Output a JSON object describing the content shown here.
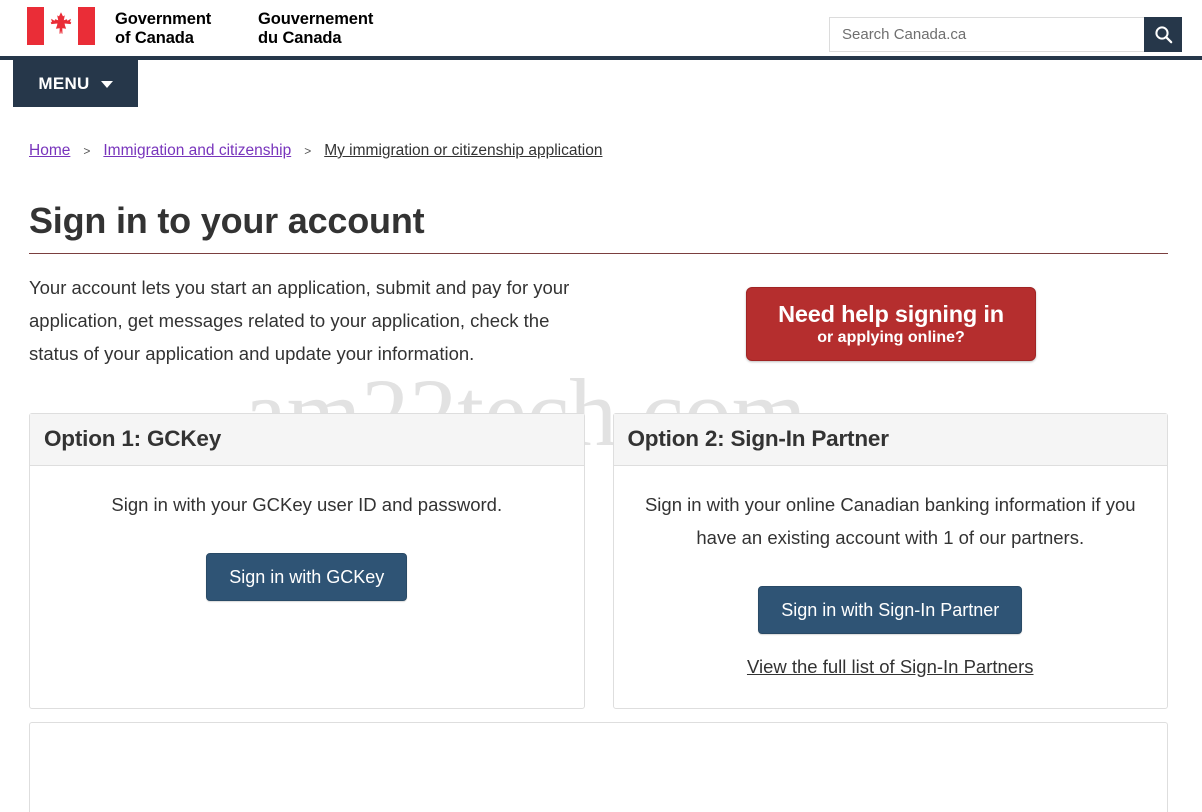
{
  "header": {
    "logo_alt": "Government of Canada / Gouvernement du Canada",
    "wordmark": {
      "en_line1": "Government",
      "en_line2": "of Canada",
      "fr_line1": "Gouvernement",
      "fr_line2": "du Canada"
    },
    "search": {
      "placeholder": "Search Canada.ca",
      "value": "",
      "button_icon": "search-icon"
    },
    "menu": {
      "label": "MENU",
      "caret_icon": "chevron-down-icon"
    }
  },
  "breadcrumb": {
    "separator": ">",
    "items": [
      {
        "label": "Home",
        "state": "visited"
      },
      {
        "label": "Immigration and citizenship",
        "state": "visited"
      },
      {
        "label": "My immigration or citizenship application",
        "state": "current"
      }
    ]
  },
  "main": {
    "title": "Sign in to your account",
    "intro": "Your account lets you start an application, submit and pay for your application, get messages related to your application, check the status of your application and update your information.",
    "help_button": {
      "line1": "Need help signing in",
      "line2": "or applying online?"
    },
    "options": [
      {
        "heading": "Option 1: GCKey",
        "description": "Sign in with your GCKey user ID and password.",
        "button_label": "Sign in with GCKey",
        "link_label": ""
      },
      {
        "heading": "Option 2: Sign-In Partner",
        "description": "Sign in with your online Canadian banking information if you have an existing account with 1 of our partners.",
        "button_label": "Sign in with Sign-In Partner",
        "link_label": "View the full list of Sign-In Partners"
      }
    ]
  },
  "watermark": {
    "text": "am22tech.com"
  },
  "colors": {
    "header_band": "#26374a",
    "menu_bar": "#26374a",
    "help_button": "#b52e2e",
    "signin_button": "#2f5475",
    "title_rule": "#7b3f3f",
    "link_visited": "#7834bc",
    "panel_heading_bg": "#f5f5f5",
    "flag_red": "#ea2d37"
  }
}
